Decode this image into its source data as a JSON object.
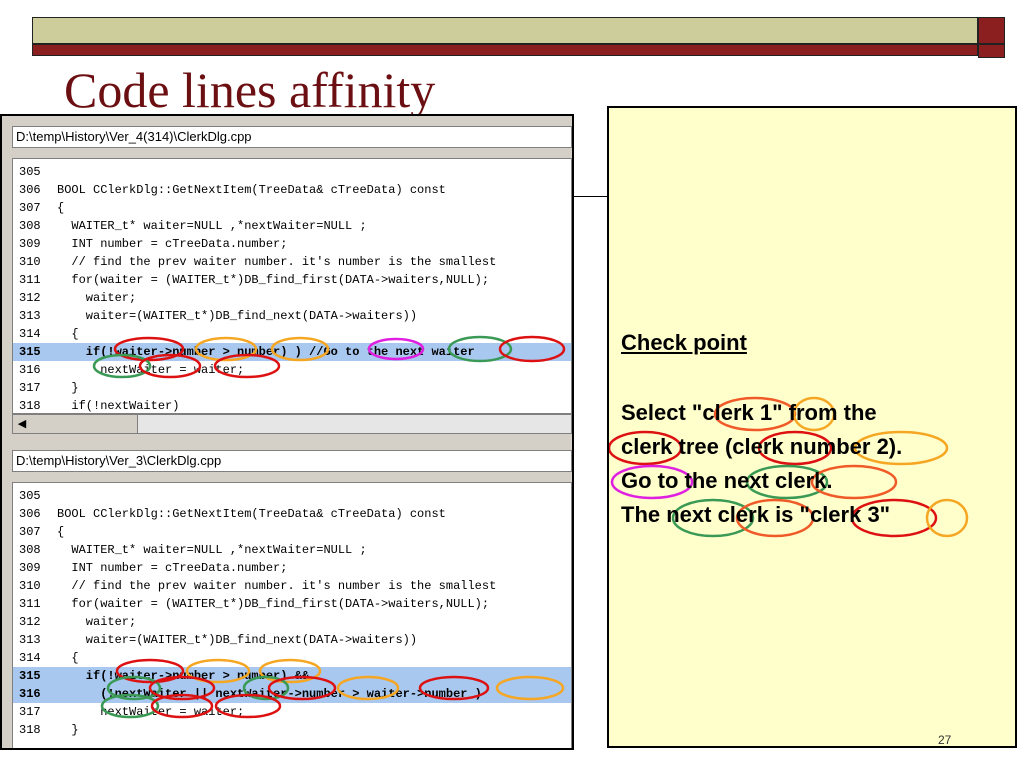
{
  "slide": {
    "title": "Code lines affinity",
    "page_number": "27"
  },
  "top_pane": {
    "path": "D:\\temp\\History\\Ver_4(314)\\ClerkDlg.cpp",
    "lines": [
      {
        "num": "305",
        "code": ""
      },
      {
        "num": "306",
        "code": "BOOL CClerkDlg::GetNextItem(TreeData& cTreeData) const"
      },
      {
        "num": "307",
        "code": "{"
      },
      {
        "num": "308",
        "code": "  WAITER_t* waiter=NULL ,*nextWaiter=NULL ;"
      },
      {
        "num": "309",
        "code": "  INT number = cTreeData.number;"
      },
      {
        "num": "310",
        "code": "  // find the prev waiter number. it's number is the smallest"
      },
      {
        "num": "311",
        "code": "  for(waiter = (WAITER_t*)DB_find_first(DATA->waiters,NULL);"
      },
      {
        "num": "312",
        "code": "    waiter;"
      },
      {
        "num": "313",
        "code": "    waiter=(WAITER_t*)DB_find_next(DATA->waiters))"
      },
      {
        "num": "314",
        "code": "  {"
      },
      {
        "num": "315",
        "code": "    if(!waiter->number > number) ) //Go to the next waiter"
      },
      {
        "num": "316",
        "code": "      nextWaiter = waiter;"
      },
      {
        "num": "317",
        "code": "  }"
      },
      {
        "num": "318",
        "code": "  if(!nextWaiter)"
      }
    ]
  },
  "bottom_pane": {
    "path": "D:\\temp\\History\\Ver_3\\ClerkDlg.cpp",
    "lines": [
      {
        "num": "305",
        "code": ""
      },
      {
        "num": "306",
        "code": "BOOL CClerkDlg::GetNextItem(TreeData& cTreeData) const"
      },
      {
        "num": "307",
        "code": "{"
      },
      {
        "num": "308",
        "code": "  WAITER_t* waiter=NULL ,*nextWaiter=NULL ;"
      },
      {
        "num": "309",
        "code": "  INT number = cTreeData.number;"
      },
      {
        "num": "310",
        "code": "  // find the prev waiter number. it's number is the smallest"
      },
      {
        "num": "311",
        "code": "  for(waiter = (WAITER_t*)DB_find_first(DATA->waiters,NULL);"
      },
      {
        "num": "312",
        "code": "    waiter;"
      },
      {
        "num": "313",
        "code": "    waiter=(WAITER_t*)DB_find_next(DATA->waiters))"
      },
      {
        "num": "314",
        "code": "  {"
      },
      {
        "num": "315",
        "code": "    if(!waiter->number > number) &&"
      },
      {
        "num": "316",
        "code": "      (!nextWaiter || nextWaiter->number > waiter->number )"
      },
      {
        "num": "317",
        "code": "      nextWaiter = waiter;"
      },
      {
        "num": "318",
        "code": "  }"
      }
    ]
  },
  "note": {
    "heading": "Check point",
    "lines": [
      "Select \"clerk 1\" from the",
      "clerk tree (clerk number 2).",
      "Go to the next clerk.",
      "The next clerk is \"clerk 3\""
    ]
  },
  "colors": {
    "title": "#6b0f12",
    "header_bar": "#cdcd9c",
    "header_accent": "#8b1e1e",
    "note_background": "#ffffcc",
    "highlight_line": "#a8c8f0",
    "ellipse_red": "#dd1111",
    "ellipse_orange": "#f5a623",
    "ellipse_green": "#3a9a55",
    "ellipse_magenta": "#e020e0",
    "ellipse_orange_red": "#f05a28"
  },
  "icons": {
    "scroll_left": "scroll-left-arrow-icon"
  }
}
